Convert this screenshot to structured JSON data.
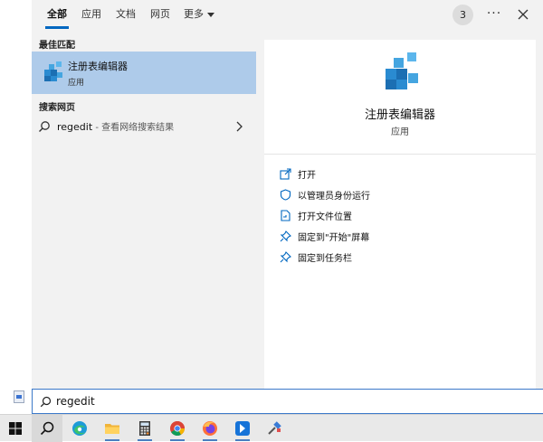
{
  "tabs": [
    {
      "label": "全部"
    },
    {
      "label": "应用"
    },
    {
      "label": "文档"
    },
    {
      "label": "网页"
    },
    {
      "label": "更多"
    }
  ],
  "header": {
    "badge_count": "3",
    "more_options": "···"
  },
  "best_match": {
    "section_title": "最佳匹配",
    "name": "注册表编辑器",
    "type": "应用"
  },
  "web_search": {
    "section_title": "搜索网页",
    "query": "regedit",
    "hint": " - 查看网络搜索结果"
  },
  "detail": {
    "title": "注册表编辑器",
    "type": "应用",
    "actions": [
      {
        "label": "打开",
        "icon": "open-icon"
      },
      {
        "label": "以管理员身份运行",
        "icon": "shield-icon"
      },
      {
        "label": "打开文件位置",
        "icon": "file-location-icon"
      },
      {
        "label": "固定到\"开始\"屏幕",
        "icon": "pin-icon"
      },
      {
        "label": "固定到任务栏",
        "icon": "pin-icon"
      }
    ]
  },
  "search": {
    "value": "regedit"
  },
  "taskbar": {
    "items": [
      "windows-start-icon",
      "search-icon",
      "edge-icon",
      "file-explorer-icon",
      "calculator-icon",
      "chrome-icon",
      "firefox-icon",
      "store-app-icon",
      "registry-tool-icon"
    ]
  },
  "colors": {
    "accent": "#0067c0",
    "selection": "#aecbea",
    "panel": "#f2f2f2"
  }
}
